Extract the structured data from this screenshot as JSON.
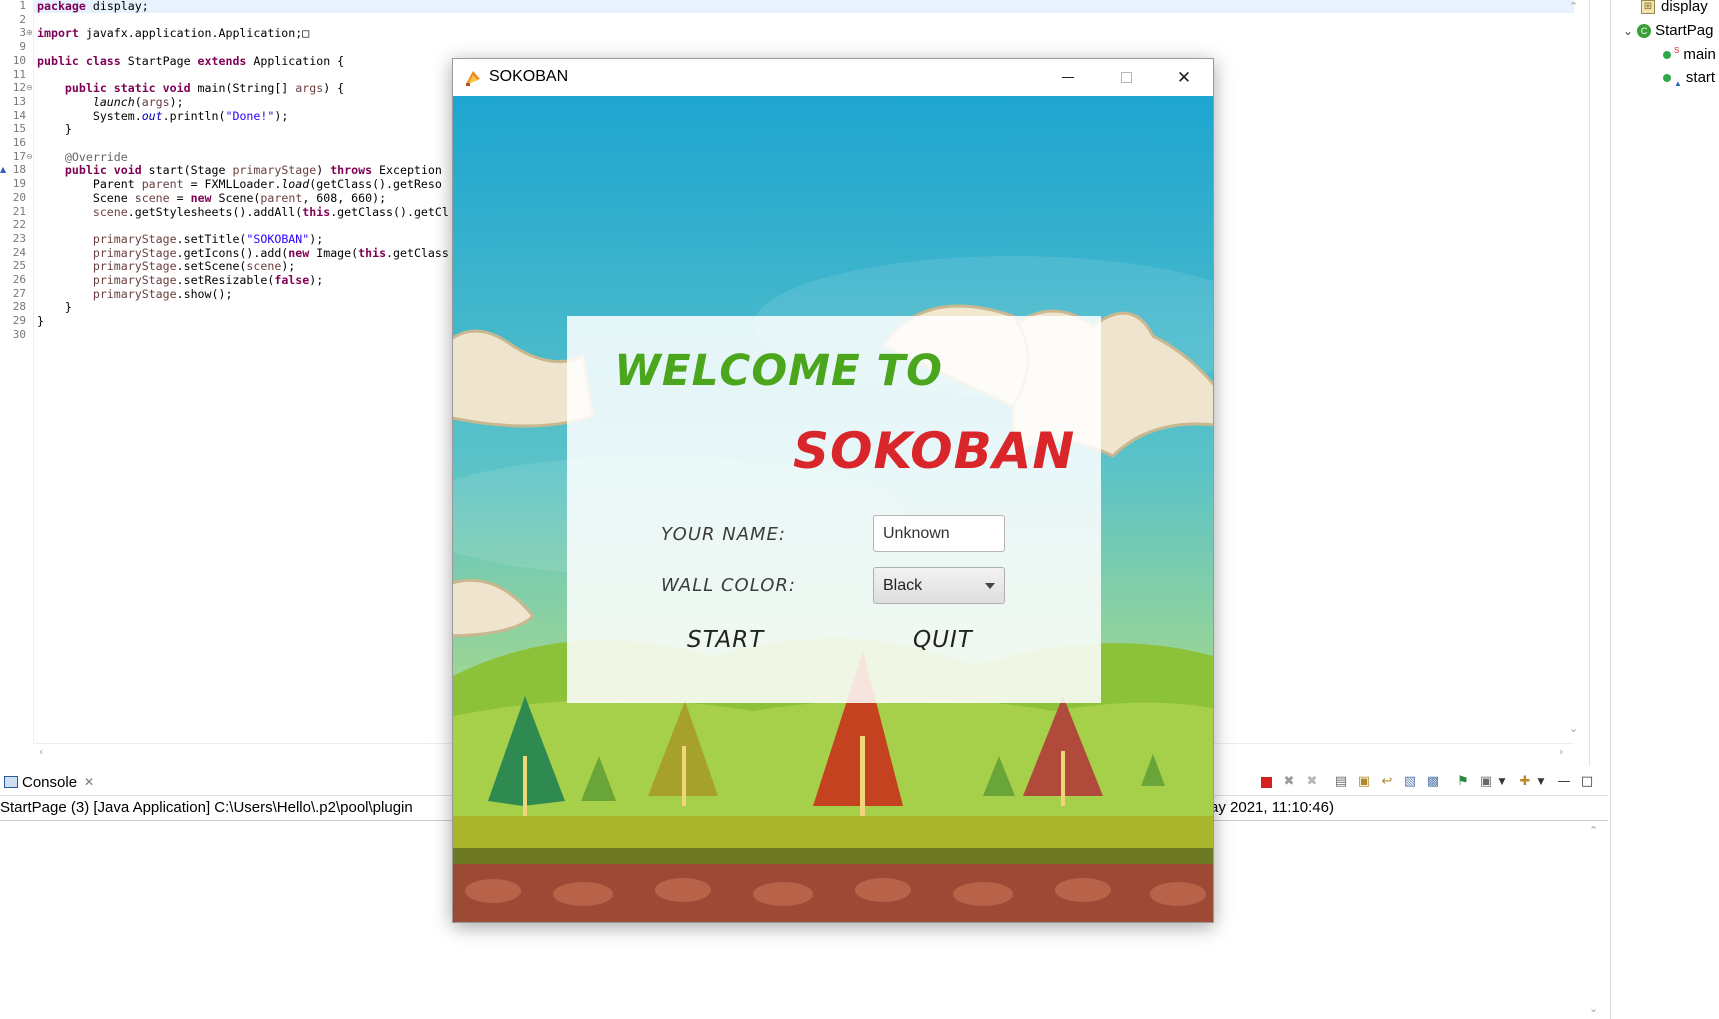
{
  "editor": {
    "lines": [
      {
        "num": "1",
        "html": "<span class=\"kw\">package</span> display;"
      },
      {
        "num": "2",
        "html": ""
      },
      {
        "num": "3",
        "html": "<span class=\"kw\">import</span> javafx.application.Application;&#9633;"
      },
      {
        "num": "9",
        "html": ""
      },
      {
        "num": "10",
        "html": "<span class=\"kw\">public class</span> StartPage <span class=\"kw\">extends</span> Application {"
      },
      {
        "num": "11",
        "html": ""
      },
      {
        "num": "12",
        "html": "    <span class=\"kw\">public static void</span> main(String[] <span class=\"var\">args</span>) {"
      },
      {
        "num": "13",
        "html": "        <span class=\"it\">launch</span>(<span class=\"var\">args</span>);"
      },
      {
        "num": "14",
        "html": "        System.<span class=\"fld\">out</span>.println(<span class=\"str\">\"Done!\"</span>);"
      },
      {
        "num": "15",
        "html": "    }"
      },
      {
        "num": "16",
        "html": ""
      },
      {
        "num": "17",
        "html": "    <span class=\"ann\">@Override</span>"
      },
      {
        "num": "18",
        "html": "    <span class=\"kw\">public void</span> start(Stage <span class=\"var\">primaryStage</span>) <span class=\"kw\">throws</span> Exception"
      },
      {
        "num": "19",
        "html": "        Parent <span class=\"var\">parent</span> = FXMLLoader.<span class=\"it\">load</span>(getClass().getReso"
      },
      {
        "num": "20",
        "html": "        Scene <span class=\"var\">scene</span> = <span class=\"kw\">new</span> Scene(<span class=\"var\">parent</span>, 608, 660);"
      },
      {
        "num": "21",
        "html": "        <span class=\"var\">scene</span>.getStylesheets().addAll(<span class=\"kw\">this</span>.getClass().getCl"
      },
      {
        "num": "22",
        "html": ""
      },
      {
        "num": "23",
        "html": "        <span class=\"var\">primaryStage</span>.setTitle(<span class=\"str\">\"SOKOBAN\"</span>);"
      },
      {
        "num": "24",
        "html": "        <span class=\"var\">primaryStage</span>.getIcons().add(<span class=\"kw\">new</span> Image(<span class=\"kw\">this</span>.getClass"
      },
      {
        "num": "25",
        "html": "        <span class=\"var\">primaryStage</span>.setScene(<span class=\"var\">scene</span>);"
      },
      {
        "num": "26",
        "html": "        <span class=\"var\">primaryStage</span>.setResizable(<span class=\"kw\">false</span>);"
      },
      {
        "num": "27",
        "html": "        <span class=\"var\">primaryStage</span>.show();"
      },
      {
        "num": "28",
        "html": "    }"
      },
      {
        "num": "29",
        "html": "}"
      },
      {
        "num": "30",
        "html": ""
      }
    ],
    "fold_markers": {
      "3": "⊕",
      "12": "⊖",
      "17": "⊖"
    },
    "override_marker_line": "18",
    "colors": {
      "keyword": "#7f0055",
      "string": "#2a00ff",
      "annotation": "#646464",
      "field": "#0000c0",
      "local_variable": "#6a3e3e",
      "current_line": "#e8f2fe"
    }
  },
  "outline": {
    "package_label": "display",
    "class_label": "StartPag",
    "items": [
      {
        "label": "main",
        "icon": "public-static-method-icon"
      },
      {
        "label": "start",
        "icon": "public-override-method-icon"
      }
    ]
  },
  "console": {
    "tab_label": "Console",
    "description": "StartPage (3) [Java Application] C:\\Users\\Hello\\.p2\\pool\\plugin",
    "date_tail": "ay 2021, 11:10:46)"
  },
  "sokoban_window": {
    "title": "SOKOBAN",
    "welcome_text": "WELCOME TO",
    "game_title": "SOKOBAN",
    "name_label": "YOUR NAME:",
    "name_value": "Unknown",
    "wall_color_label": "WALL COLOR:",
    "wall_color_value": "Black",
    "start_label": "START",
    "quit_label": "QUIT",
    "colors": {
      "welcome": "#4ba51d",
      "sokoban": "#d8262b",
      "sky_top": "#1ea5d0",
      "grass": "#8cc13a",
      "ground": "#a24c37"
    }
  }
}
